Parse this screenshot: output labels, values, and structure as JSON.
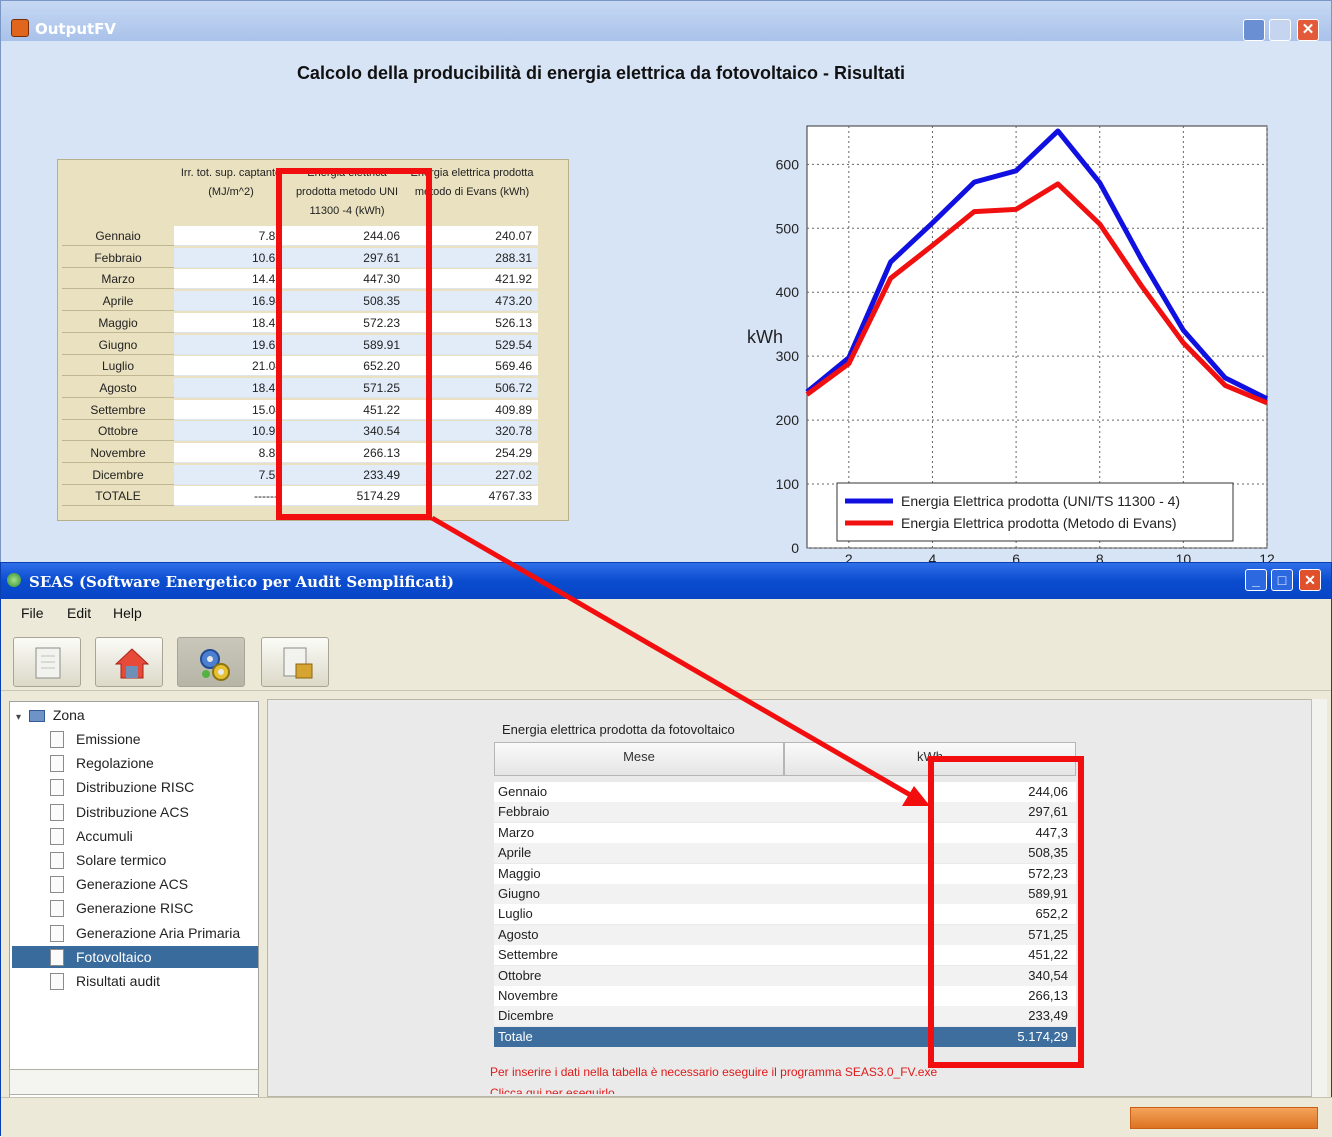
{
  "output_window": {
    "title": "OutputFV",
    "heading": "Calcolo della producibilità di energia elettrica da fotovoltaico - Risultati",
    "table": {
      "headers": [
        "Irr. tot. sup. captante (MJ/m^2)",
        "Energia elettrica prodotta metodo UNI 11300 -4 (kWh)",
        "Energia elettrica prodotta metodo di Evans (kWh)"
      ],
      "rows": [
        {
          "month": "Gennaio",
          "irr": "7.87",
          "uni": "244.06",
          "evans": "240.07"
        },
        {
          "month": "Febbraio",
          "irr": "10.63",
          "uni": "297.61",
          "evans": "288.31"
        },
        {
          "month": "Marzo",
          "irr": "14.43",
          "uni": "447.30",
          "evans": "421.92"
        },
        {
          "month": "Aprile",
          "irr": "16.94",
          "uni": "508.35",
          "evans": "473.20"
        },
        {
          "month": "Maggio",
          "irr": "18.46",
          "uni": "572.23",
          "evans": "526.13"
        },
        {
          "month": "Giugno",
          "irr": "19.66",
          "uni": "589.91",
          "evans": "529.54"
        },
        {
          "month": "Luglio",
          "irr": "21.04",
          "uni": "652.20",
          "evans": "569.46"
        },
        {
          "month": "Agosto",
          "irr": "18.43",
          "uni": "571.25",
          "evans": "506.72"
        },
        {
          "month": "Settembre",
          "irr": "15.04",
          "uni": "451.22",
          "evans": "409.89"
        },
        {
          "month": "Ottobre",
          "irr": "10.99",
          "uni": "340.54",
          "evans": "320.78"
        },
        {
          "month": "Novembre",
          "irr": "8.87",
          "uni": "266.13",
          "evans": "254.29"
        },
        {
          "month": "Dicembre",
          "irr": "7.53",
          "uni": "233.49",
          "evans": "227.02"
        },
        {
          "month": "TOTALE",
          "irr": "-------",
          "uni": "5174.29",
          "evans": "4767.33"
        }
      ]
    }
  },
  "chart_data": {
    "type": "line",
    "x": [
      1,
      2,
      3,
      4,
      5,
      6,
      7,
      8,
      9,
      10,
      11,
      12
    ],
    "ylabel": "kWh",
    "xticks": [
      "2",
      "4",
      "6",
      "8",
      "10",
      "12"
    ],
    "yticks": [
      "0",
      "100",
      "200",
      "300",
      "400",
      "500",
      "600"
    ],
    "ylim": [
      0,
      660
    ],
    "xlim": [
      1,
      12
    ],
    "grid": true,
    "legend_position": "bottom-right",
    "series": [
      {
        "name": "Energia Elettrica prodotta (UNI/TS 11300 - 4)",
        "color": "#1010e0",
        "values": [
          244.06,
          297.61,
          447.3,
          508.35,
          572.23,
          589.91,
          652.2,
          571.25,
          451.22,
          340.54,
          266.13,
          233.49
        ]
      },
      {
        "name": "Energia Elettrica prodotta (Metodo di Evans)",
        "color": "#f01010",
        "values": [
          240.07,
          288.31,
          421.92,
          473.2,
          526.13,
          529.54,
          569.46,
          506.72,
          409.89,
          320.78,
          254.29,
          227.02
        ]
      }
    ]
  },
  "seas_window": {
    "title": "SEAS (Software Energetico per Audit Semplificati)",
    "menu": [
      "File",
      "Edit",
      "Help"
    ],
    "tree": {
      "root": "Zona",
      "items": [
        "Emissione",
        "Regolazione",
        "Distribuzione RISC",
        "Distribuzione ACS",
        "Accumuli",
        "Solare termico",
        "Generazione ACS",
        "Generazione RISC",
        "Generazione Aria Primaria",
        "Fotovoltaico",
        "Risultati audit"
      ],
      "selected": "Fotovoltaico"
    },
    "table_caption": "Energia elettrica prodotta da fotovoltaico",
    "col_month": "Mese",
    "col_kwh": "kWh",
    "rows": [
      {
        "month": "Gennaio",
        "kwh": "244,06"
      },
      {
        "month": "Febbraio",
        "kwh": "297,61"
      },
      {
        "month": "Marzo",
        "kwh": "447,3"
      },
      {
        "month": "Aprile",
        "kwh": "508,35"
      },
      {
        "month": "Maggio",
        "kwh": "572,23"
      },
      {
        "month": "Giugno",
        "kwh": "589,91"
      },
      {
        "month": "Luglio",
        "kwh": "652,2"
      },
      {
        "month": "Agosto",
        "kwh": "571,25"
      },
      {
        "month": "Settembre",
        "kwh": "451,22"
      },
      {
        "month": "Ottobre",
        "kwh": "340,54"
      },
      {
        "month": "Novembre",
        "kwh": "266,13"
      },
      {
        "month": "Dicembre",
        "kwh": "233,49"
      }
    ],
    "total": {
      "month": "Totale",
      "kwh": "5.174,29"
    },
    "note": "Per inserire i dati nella tabella è necessario eseguire il programma SEAS3.0_FV.exe",
    "note2": "Clicca qui per eseguirlo"
  },
  "colors": {
    "annotation": "#f20e0e",
    "selection": "#3a6b9d"
  }
}
